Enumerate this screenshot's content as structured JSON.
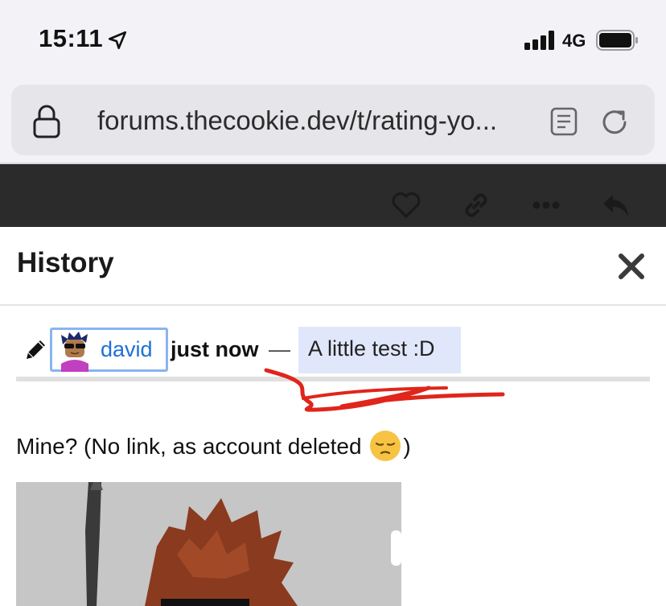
{
  "status_bar": {
    "time": "15:11",
    "network": "4G",
    "icons": [
      "location-arrow-icon",
      "signal-bars-icon",
      "battery-icon"
    ]
  },
  "browser": {
    "url": "forums.thecookie.dev/t/rating-yo...",
    "icons": [
      "lock-icon",
      "reader-mode-icon",
      "reload-icon"
    ]
  },
  "post_toolbar": {
    "icons": [
      "heart-icon",
      "link-icon",
      "more-icon",
      "reply-icon"
    ]
  },
  "modal": {
    "title": "History",
    "revision": {
      "username": "david",
      "timestamp": "just now",
      "separator": "—",
      "edit_reason": "A little test :D"
    },
    "post_text_before": "Mine? (No link, as account deleted ",
    "post_text_after": ")",
    "emoji": "pensive-face"
  },
  "colors": {
    "link": "#1e6fd9",
    "highlight": "#e1e7fb",
    "annotation": "#e0251b",
    "toolbar": "#2b2b2b"
  }
}
